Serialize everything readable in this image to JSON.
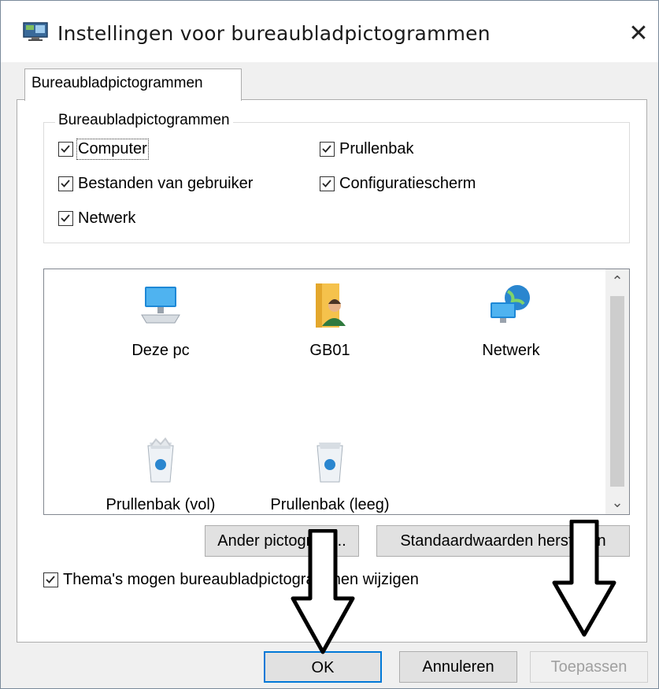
{
  "window": {
    "title": "Instellingen voor bureaubladpictogrammen",
    "close_glyph": "✕"
  },
  "tab": {
    "label": "Bureaubladpictogrammen"
  },
  "group": {
    "legend": "Bureaubladpictogrammen",
    "checkboxes": [
      {
        "label": "Computer",
        "checked": true
      },
      {
        "label": "Prullenbak",
        "checked": true
      },
      {
        "label": "Bestanden van gebruiker",
        "checked": true
      },
      {
        "label": "Configuratiescherm",
        "checked": true
      },
      {
        "label": "Netwerk",
        "checked": true
      }
    ]
  },
  "icons": [
    {
      "label": "Deze pc",
      "icon": "computer-icon"
    },
    {
      "label": "GB01",
      "icon": "user-folder-icon"
    },
    {
      "label": "Netwerk",
      "icon": "network-icon"
    },
    {
      "label": "Prullenbak (vol)",
      "icon": "recycle-bin-full-icon"
    },
    {
      "label": "Prullenbak (leeg)",
      "icon": "recycle-bin-empty-icon"
    }
  ],
  "buttons": {
    "change_icon": "Ander pictogram...",
    "restore_default": "Standaardwaarden herstellen",
    "ok": "OK",
    "cancel": "Annuleren",
    "apply": "Toepassen"
  },
  "themes_checkbox": {
    "label": "Thema's mogen bureaubladpictogrammen wijzigen",
    "checked": true
  },
  "colors": {
    "accent": "#0078d7",
    "disabled_text": "#a0a0a0"
  }
}
